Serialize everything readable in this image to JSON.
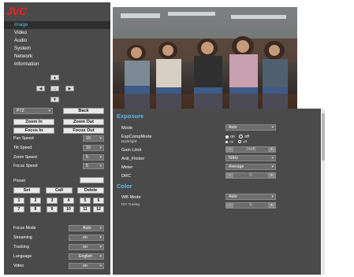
{
  "app": {
    "logo": "JVC"
  },
  "nav": {
    "items": [
      {
        "label": "Image",
        "active": true
      },
      {
        "label": "Video",
        "active": false
      },
      {
        "label": "Audio",
        "active": false
      },
      {
        "label": "System",
        "active": false
      },
      {
        "label": "Network",
        "active": false
      },
      {
        "label": "Information",
        "active": false
      }
    ]
  },
  "ptz": {
    "mode": "PTZ",
    "back": "Back",
    "zoom_in": "Zoom In",
    "zoom_out": "Zoom Out",
    "focus_in": "Focus In",
    "focus_out": "Focus Out",
    "speeds": [
      {
        "label": "Pan Speed",
        "value": "10"
      },
      {
        "label": "Tilt Speed",
        "value": "10"
      },
      {
        "label": "Zoom Speed",
        "value": "5"
      },
      {
        "label": "Focus Speed",
        "value": "5"
      }
    ]
  },
  "preset": {
    "label": "Preset",
    "set": "Set",
    "call": "Call",
    "delete": "Delete",
    "numbers": [
      "1",
      "2",
      "3",
      "4",
      "5",
      "6",
      "7",
      "8",
      "9",
      "10",
      "11",
      "12"
    ]
  },
  "bottom": [
    {
      "label": "Focus Mode",
      "value": "Auto"
    },
    {
      "label": "Streaming",
      "value": "on"
    },
    {
      "label": "Tracking",
      "value": "on"
    },
    {
      "label": "Language",
      "value": "English"
    },
    {
      "label": "Video",
      "value": "on"
    }
  ],
  "panel": {
    "exposure_title": "Exposure",
    "mode_label": "Mode",
    "mode_value": "Auto",
    "expcomp_label": "ExpCompMode",
    "expcomp_on": "on",
    "expcomp_off": "off",
    "backlight_label": "Backlight",
    "backlight_on": "on",
    "backlight_off": "off",
    "gain_label": "Gain Limit",
    "gain_value": "24dB",
    "flicker_label": "Anti_Flicker",
    "flicker_value": "50Hz",
    "meter_label": "Meter",
    "meter_value": "Average",
    "drc_label": "DRC",
    "drc_value": "0",
    "color_title": "Color",
    "wb_label": "WB Mode",
    "wb_value": "Auto",
    "rg_label": "RG Tuning",
    "rg_value": "0"
  },
  "icons": {
    "up": "up-arrow-icon",
    "down": "down-arrow-icon",
    "left": "left-arrow-icon",
    "right": "right-arrow-icon",
    "home": "home-icon"
  }
}
